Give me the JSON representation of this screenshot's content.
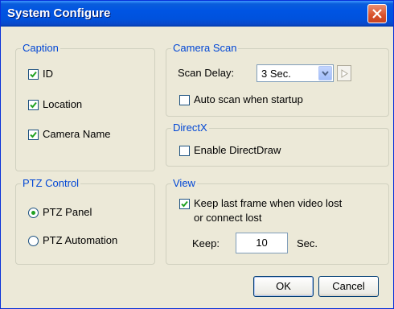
{
  "window": {
    "title": "System Configure"
  },
  "caption": {
    "legend": "Caption",
    "items": [
      {
        "label": "ID",
        "checked": true
      },
      {
        "label": "Location",
        "checked": true
      },
      {
        "label": "Camera Name",
        "checked": true
      }
    ]
  },
  "camera_scan": {
    "legend": "Camera Scan",
    "scan_delay_label": "Scan Delay:",
    "scan_delay_value": "3 Sec.",
    "auto_scan_label": "Auto scan when startup",
    "auto_scan_checked": false
  },
  "directx": {
    "legend": "DirectX",
    "enable_label": "Enable DirectDraw",
    "enable_checked": false
  },
  "ptz": {
    "legend": "PTZ Control",
    "options": [
      {
        "label": "PTZ Panel",
        "selected": true
      },
      {
        "label": "PTZ Automation",
        "selected": false
      }
    ]
  },
  "view": {
    "legend": "View",
    "keep_frame_label_line1": "Keep last frame when video lost",
    "keep_frame_label_line2": "or connect lost",
    "keep_frame_checked": true,
    "keep_label": "Keep:",
    "keep_value": "10",
    "keep_unit": "Sec."
  },
  "buttons": {
    "ok": "OK",
    "cancel": "Cancel"
  },
  "colors": {
    "title_bar": "#0054e3",
    "group_legend": "#0046d5",
    "dialog_bg": "#ece9d8",
    "close_button": "#d8502a",
    "check_mark": "#21a121"
  }
}
